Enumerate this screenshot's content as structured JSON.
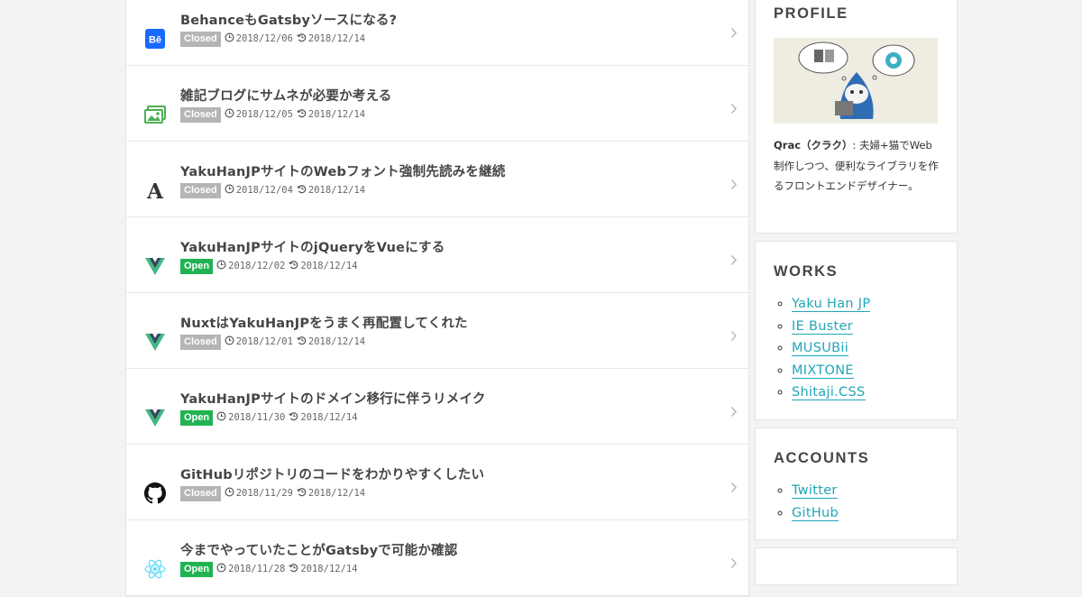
{
  "posts": [
    {
      "title": "BehanceもGatsbyソースになる?",
      "status": "Closed",
      "created": "2018/12/06",
      "updated": "2018/12/14",
      "icon": "behance-icon"
    },
    {
      "title": "雑記ブログにサムネが必要か考える",
      "status": "Closed",
      "created": "2018/12/05",
      "updated": "2018/12/14",
      "icon": "image-icon"
    },
    {
      "title": "YakuHanJPサイトのWebフォント強制先読みを継続",
      "status": "Closed",
      "created": "2018/12/04",
      "updated": "2018/12/14",
      "icon": "font-icon"
    },
    {
      "title": "YakuHanJPサイトのjQueryをVueにする",
      "status": "Open",
      "created": "2018/12/02",
      "updated": "2018/12/14",
      "icon": "vue-icon"
    },
    {
      "title": "NuxtはYakuHanJPをうまく再配置してくれた",
      "status": "Closed",
      "created": "2018/12/01",
      "updated": "2018/12/14",
      "icon": "vue-icon"
    },
    {
      "title": "YakuHanJPサイトのドメイン移行に伴うリメイク",
      "status": "Open",
      "created": "2018/11/30",
      "updated": "2018/12/14",
      "icon": "vue-icon"
    },
    {
      "title": "GitHubリポジトリのコードをわかりやすくしたい",
      "status": "Closed",
      "created": "2018/11/29",
      "updated": "2018/12/14",
      "icon": "github-icon"
    },
    {
      "title": "今までやっていたことがGatsbyで可能か確認",
      "status": "Open",
      "created": "2018/11/28",
      "updated": "2018/12/14",
      "icon": "react-icon"
    }
  ],
  "profile": {
    "heading": "PROFILE",
    "name": "Qrac（クラク）",
    "bio": ": 夫婦+猫でWeb制作しつつ、便利なライブラリを作るフロントエンドデザイナー。"
  },
  "works": {
    "heading": "WORKS",
    "items": [
      "Yaku Han JP",
      "IE Buster",
      "MUSUBii",
      "MIXTONE",
      "Shitaji.CSS"
    ]
  },
  "accounts": {
    "heading": "ACCOUNTS",
    "items": [
      "Twitter",
      "GitHub"
    ]
  },
  "colors": {
    "open": "#21b352",
    "closed": "#b5b5b5",
    "link": "#21a6b8"
  }
}
